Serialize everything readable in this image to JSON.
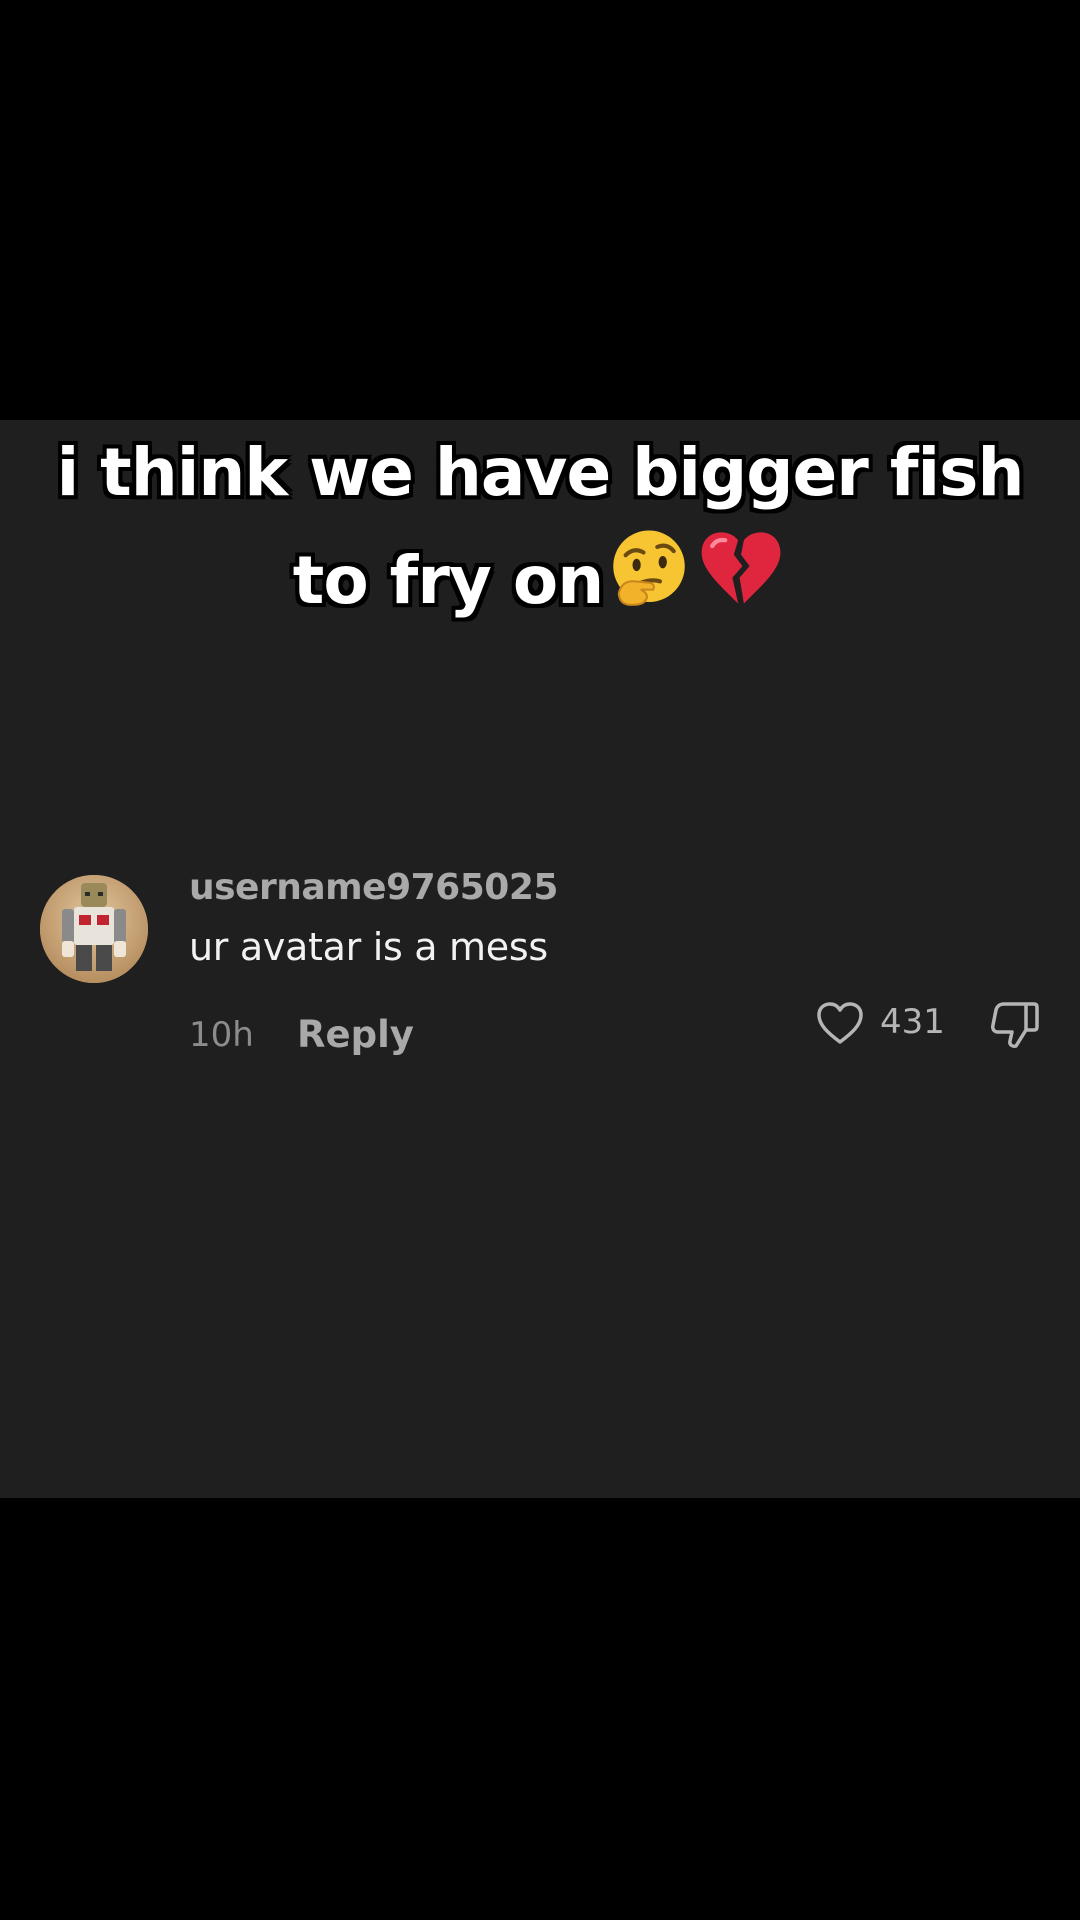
{
  "caption": {
    "line1": "i think we have bigger fish",
    "line2": "to fry on"
  },
  "comment": {
    "username": "username9765025",
    "text": "ur avatar is a mess",
    "timestamp": "10h",
    "reply_label": "Reply",
    "like_count": "431",
    "avatar_icon": "roblox-avatar-icon"
  },
  "colors": {
    "page_background": "#000000",
    "panel_background": "#1f1f1f",
    "username": "#a9a9a9",
    "comment_text": "#f2f2f2",
    "secondary_text": "#8c8c8c"
  },
  "icons": {
    "caption_emoji_1": "thinking-face-icon",
    "caption_emoji_2": "broken-heart-icon",
    "like": "heart-outline-icon",
    "dislike": "thumbs-down-icon"
  }
}
